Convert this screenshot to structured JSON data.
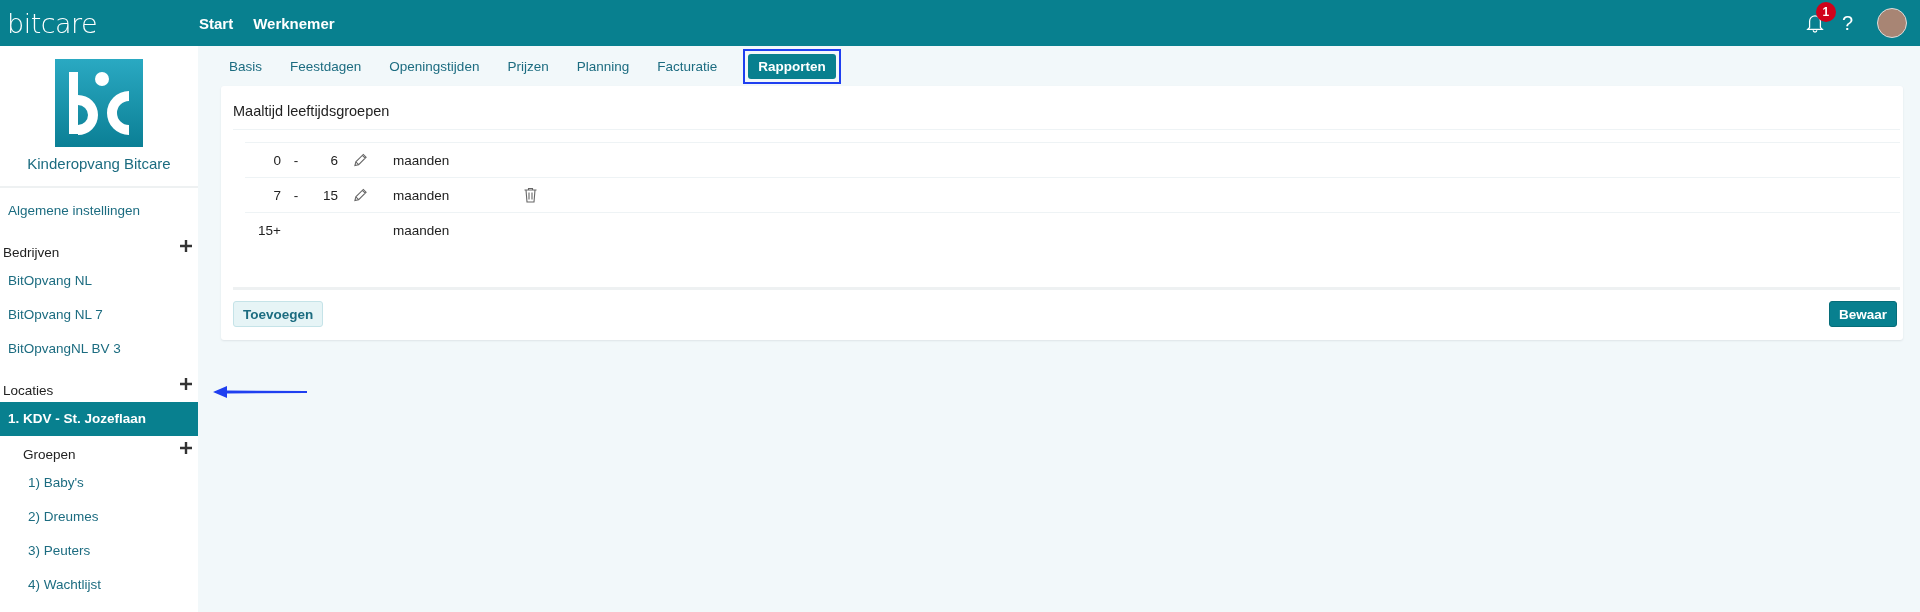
{
  "topbar": {
    "logo": "bitcare",
    "nav": [
      "Start",
      "Werknemer"
    ],
    "notification_count": "1",
    "help": "?"
  },
  "sidebar": {
    "org_name": "Kinderopvang Bitcare",
    "general": "Algemene instellingen",
    "sections": [
      {
        "title": "Bedrijven",
        "items": [
          {
            "label": "BitOpvang NL",
            "selected": false
          },
          {
            "label": "BitOpvang NL 7",
            "selected": false
          },
          {
            "label": "BitOpvangNL BV 3",
            "selected": false
          }
        ]
      },
      {
        "title": "Locaties",
        "items": [
          {
            "label": "1. KDV - St. Jozeflaan",
            "selected": true,
            "children_title": "Groepen",
            "children": [
              {
                "label": "1) Baby's"
              },
              {
                "label": "2) Dreumes"
              },
              {
                "label": "3) Peuters"
              },
              {
                "label": "4) Wachtlijst"
              }
            ]
          }
        ]
      }
    ]
  },
  "tabs": [
    {
      "label": "Basis",
      "selected": false,
      "highlighted": false
    },
    {
      "label": "Feestdagen",
      "selected": false,
      "highlighted": false
    },
    {
      "label": "Openingstijden",
      "selected": false,
      "highlighted": false
    },
    {
      "label": "Prijzen",
      "selected": false,
      "highlighted": false
    },
    {
      "label": "Planning",
      "selected": false,
      "highlighted": false
    },
    {
      "label": "Facturatie",
      "selected": false,
      "highlighted": false
    },
    {
      "label": "Rapporten",
      "selected": true,
      "highlighted": true
    }
  ],
  "card": {
    "title": "Maaltijd leeftijdsgroepen",
    "rows": [
      {
        "from": "0",
        "separator": "-",
        "to": "6",
        "editable": true,
        "unit": "maanden",
        "deletable": false
      },
      {
        "from": "7",
        "separator": "-",
        "to": "15",
        "editable": true,
        "unit": "maanden",
        "deletable": true
      },
      {
        "from": "15+",
        "unit": "maanden",
        "editable": false,
        "deletable": false
      }
    ],
    "add_button": "Toevoegen",
    "save_button": "Bewaar"
  },
  "annotation_arrow": true
}
